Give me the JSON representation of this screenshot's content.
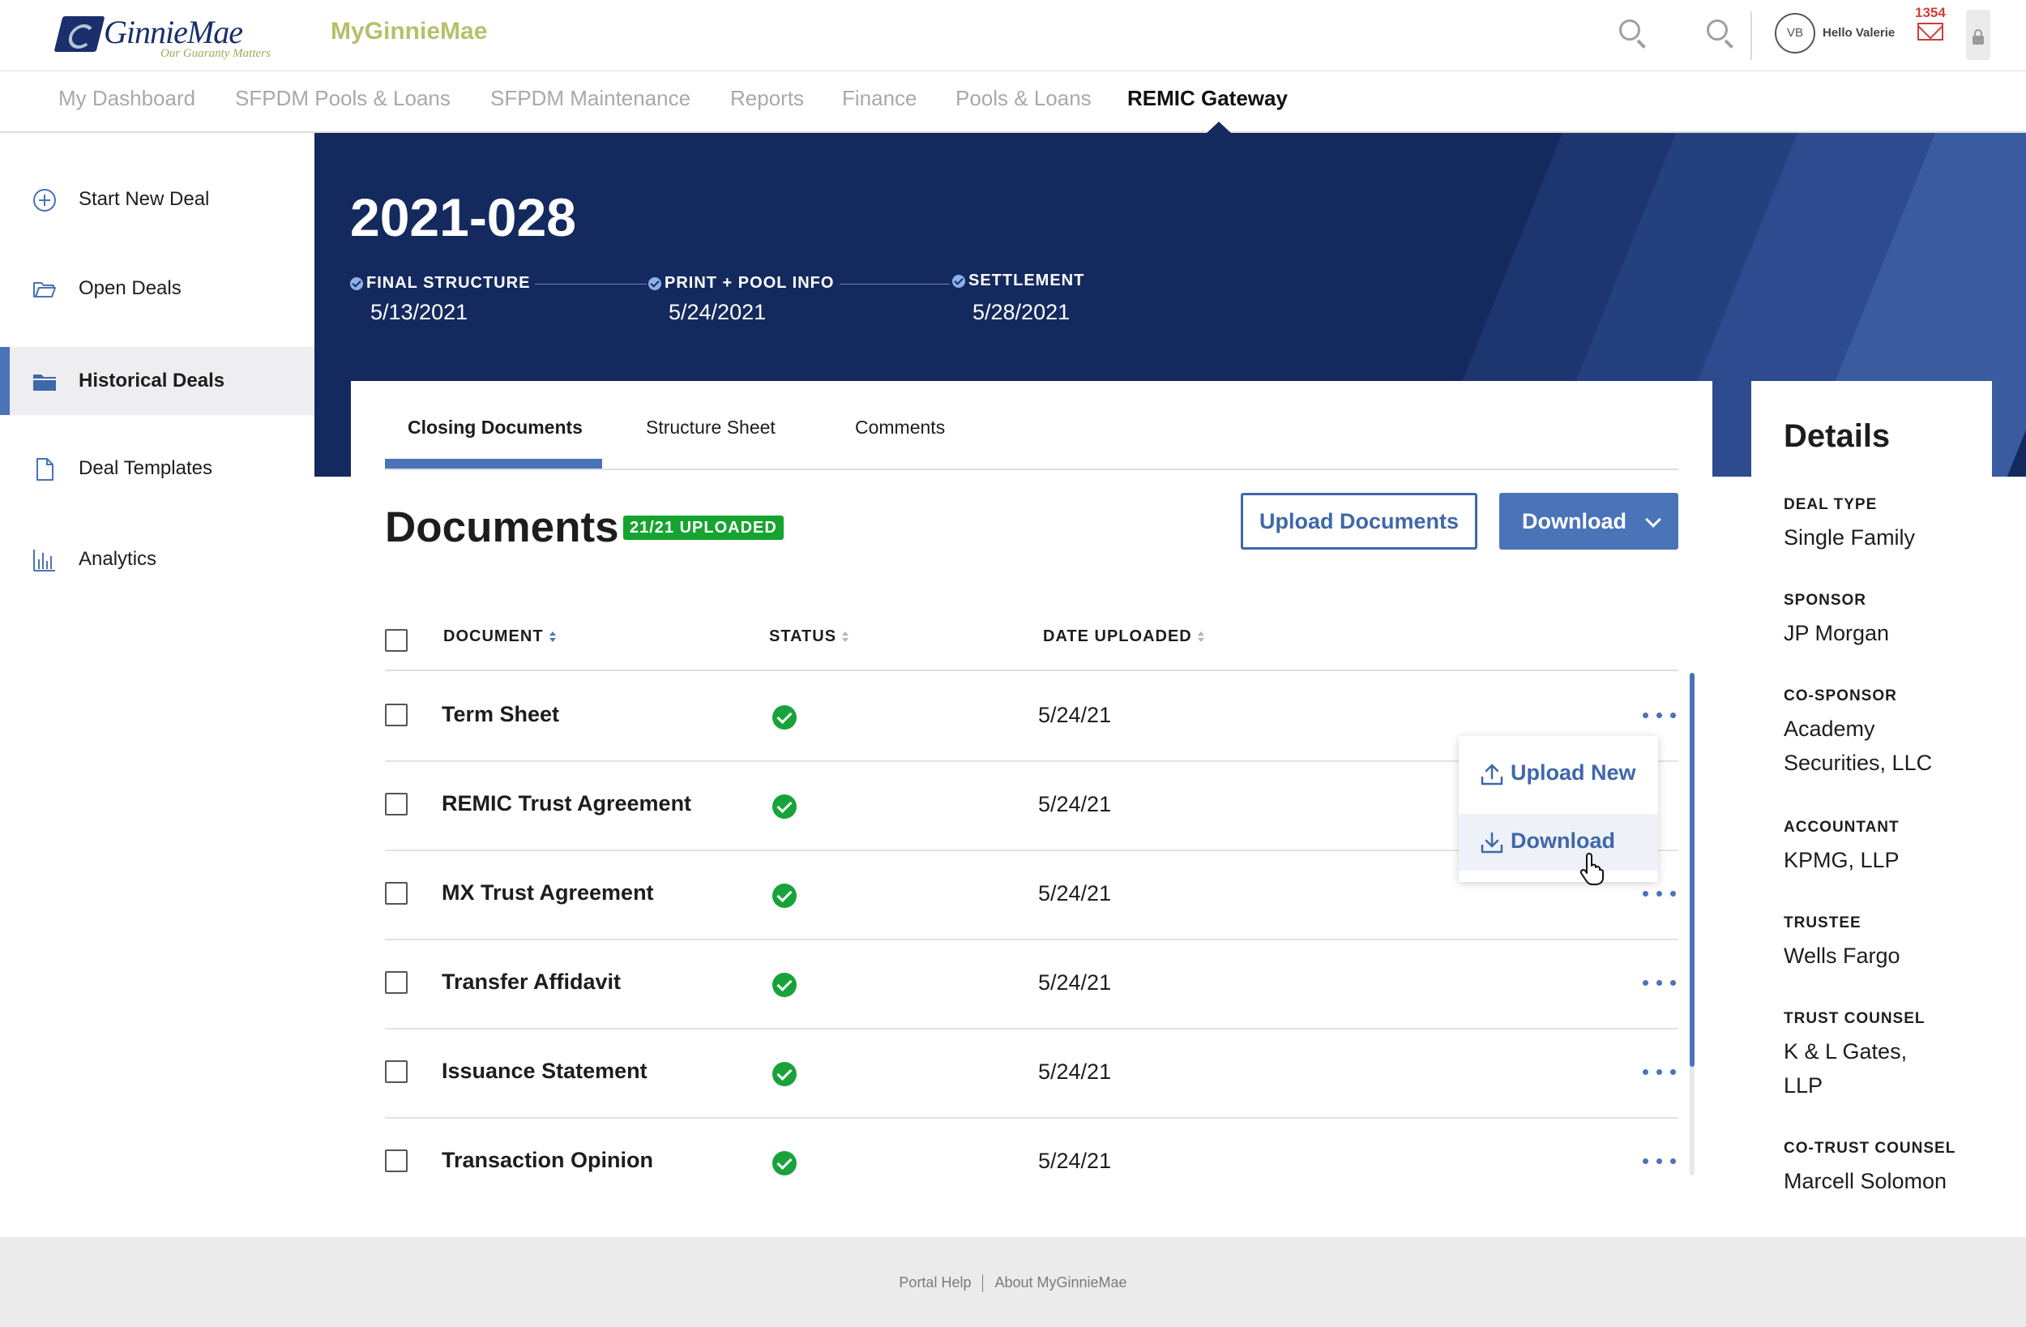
{
  "header": {
    "logo_text": "GinnieMae",
    "logo_tagline": "Our Guaranty Matters",
    "app_name": "MyGinnieMae",
    "avatar_initials": "VB",
    "greeting": "Hello Valerie",
    "mail_count": "1354",
    "icons": [
      "search-icon",
      "search-icon",
      "mail-icon",
      "lock-icon"
    ]
  },
  "nav": {
    "items": [
      {
        "label": "My Dashboard",
        "active": false
      },
      {
        "label": "SFPDM Pools & Loans",
        "active": false
      },
      {
        "label": "SFPDM Maintenance",
        "active": false
      },
      {
        "label": "Reports",
        "active": false
      },
      {
        "label": "Finance",
        "active": false
      },
      {
        "label": "Pools & Loans",
        "active": false
      },
      {
        "label": "REMIC Gateway",
        "active": true
      }
    ]
  },
  "sidebar": {
    "items": [
      {
        "label": "Start New Deal",
        "icon": "plus-circle-icon",
        "active": false
      },
      {
        "label": "Open Deals",
        "icon": "open-folder-icon",
        "active": false
      },
      {
        "label": "Historical Deals",
        "icon": "folder-icon",
        "active": true
      },
      {
        "label": "Deal Templates",
        "icon": "document-icon",
        "active": false
      },
      {
        "label": "Analytics",
        "icon": "bar-chart-icon",
        "active": false
      }
    ]
  },
  "deal": {
    "id": "2021-028",
    "milestones": [
      {
        "label": "FINAL STRUCTURE",
        "date": "5/13/2021",
        "complete": true
      },
      {
        "label": "PRINT + POOL INFO",
        "date": "5/24/2021",
        "complete": true
      },
      {
        "label": "SETTLEMENT",
        "date": "5/28/2021",
        "complete": true
      }
    ]
  },
  "tabs": [
    {
      "label": "Closing Documents",
      "active": true
    },
    {
      "label": "Structure Sheet",
      "active": false
    },
    {
      "label": "Comments",
      "active": false
    }
  ],
  "documents": {
    "title": "Documents",
    "badge": "21/21 UPLOADED",
    "upload_button": "Upload Documents",
    "download_button": "Download",
    "columns": [
      "DOCUMENT",
      "STATUS",
      "DATE UPLOADED"
    ],
    "rows": [
      {
        "name": "Term Sheet",
        "status": "uploaded",
        "date": "5/24/21"
      },
      {
        "name": "REMIC Trust Agreement",
        "status": "uploaded",
        "date": "5/24/21"
      },
      {
        "name": "MX Trust Agreement",
        "status": "uploaded",
        "date": "5/24/21"
      },
      {
        "name": "Transfer Affidavit",
        "status": "uploaded",
        "date": "5/24/21"
      },
      {
        "name": "Issuance Statement",
        "status": "uploaded",
        "date": "5/24/21"
      },
      {
        "name": "Transaction Opinion",
        "status": "uploaded",
        "date": "5/24/21"
      }
    ],
    "row_menu": {
      "upload_new": "Upload New",
      "download": "Download"
    }
  },
  "details": {
    "title": "Details",
    "fields": [
      {
        "label": "DEAL TYPE",
        "value": "Single Family"
      },
      {
        "label": "SPONSOR",
        "value": "JP Morgan"
      },
      {
        "label": "CO-SPONSOR",
        "value": "Academy Securities, LLC"
      },
      {
        "label": "ACCOUNTANT",
        "value": "KPMG, LLP"
      },
      {
        "label": "TRUSTEE",
        "value": "Wells Fargo"
      },
      {
        "label": "TRUST COUNSEL",
        "value": "K & L Gates, LLP"
      },
      {
        "label": "CO-TRUST COUNSEL",
        "value": "Marcell Solomon"
      }
    ]
  },
  "footer": {
    "links": [
      "Portal Help",
      "About MyGinnieMae"
    ]
  },
  "colors": {
    "navy": "#142a5e",
    "accent_blue": "#4a73b8",
    "success_green": "#16a32f",
    "brand_olive": "#b8bf6a",
    "alert_red": "#c9403a"
  }
}
